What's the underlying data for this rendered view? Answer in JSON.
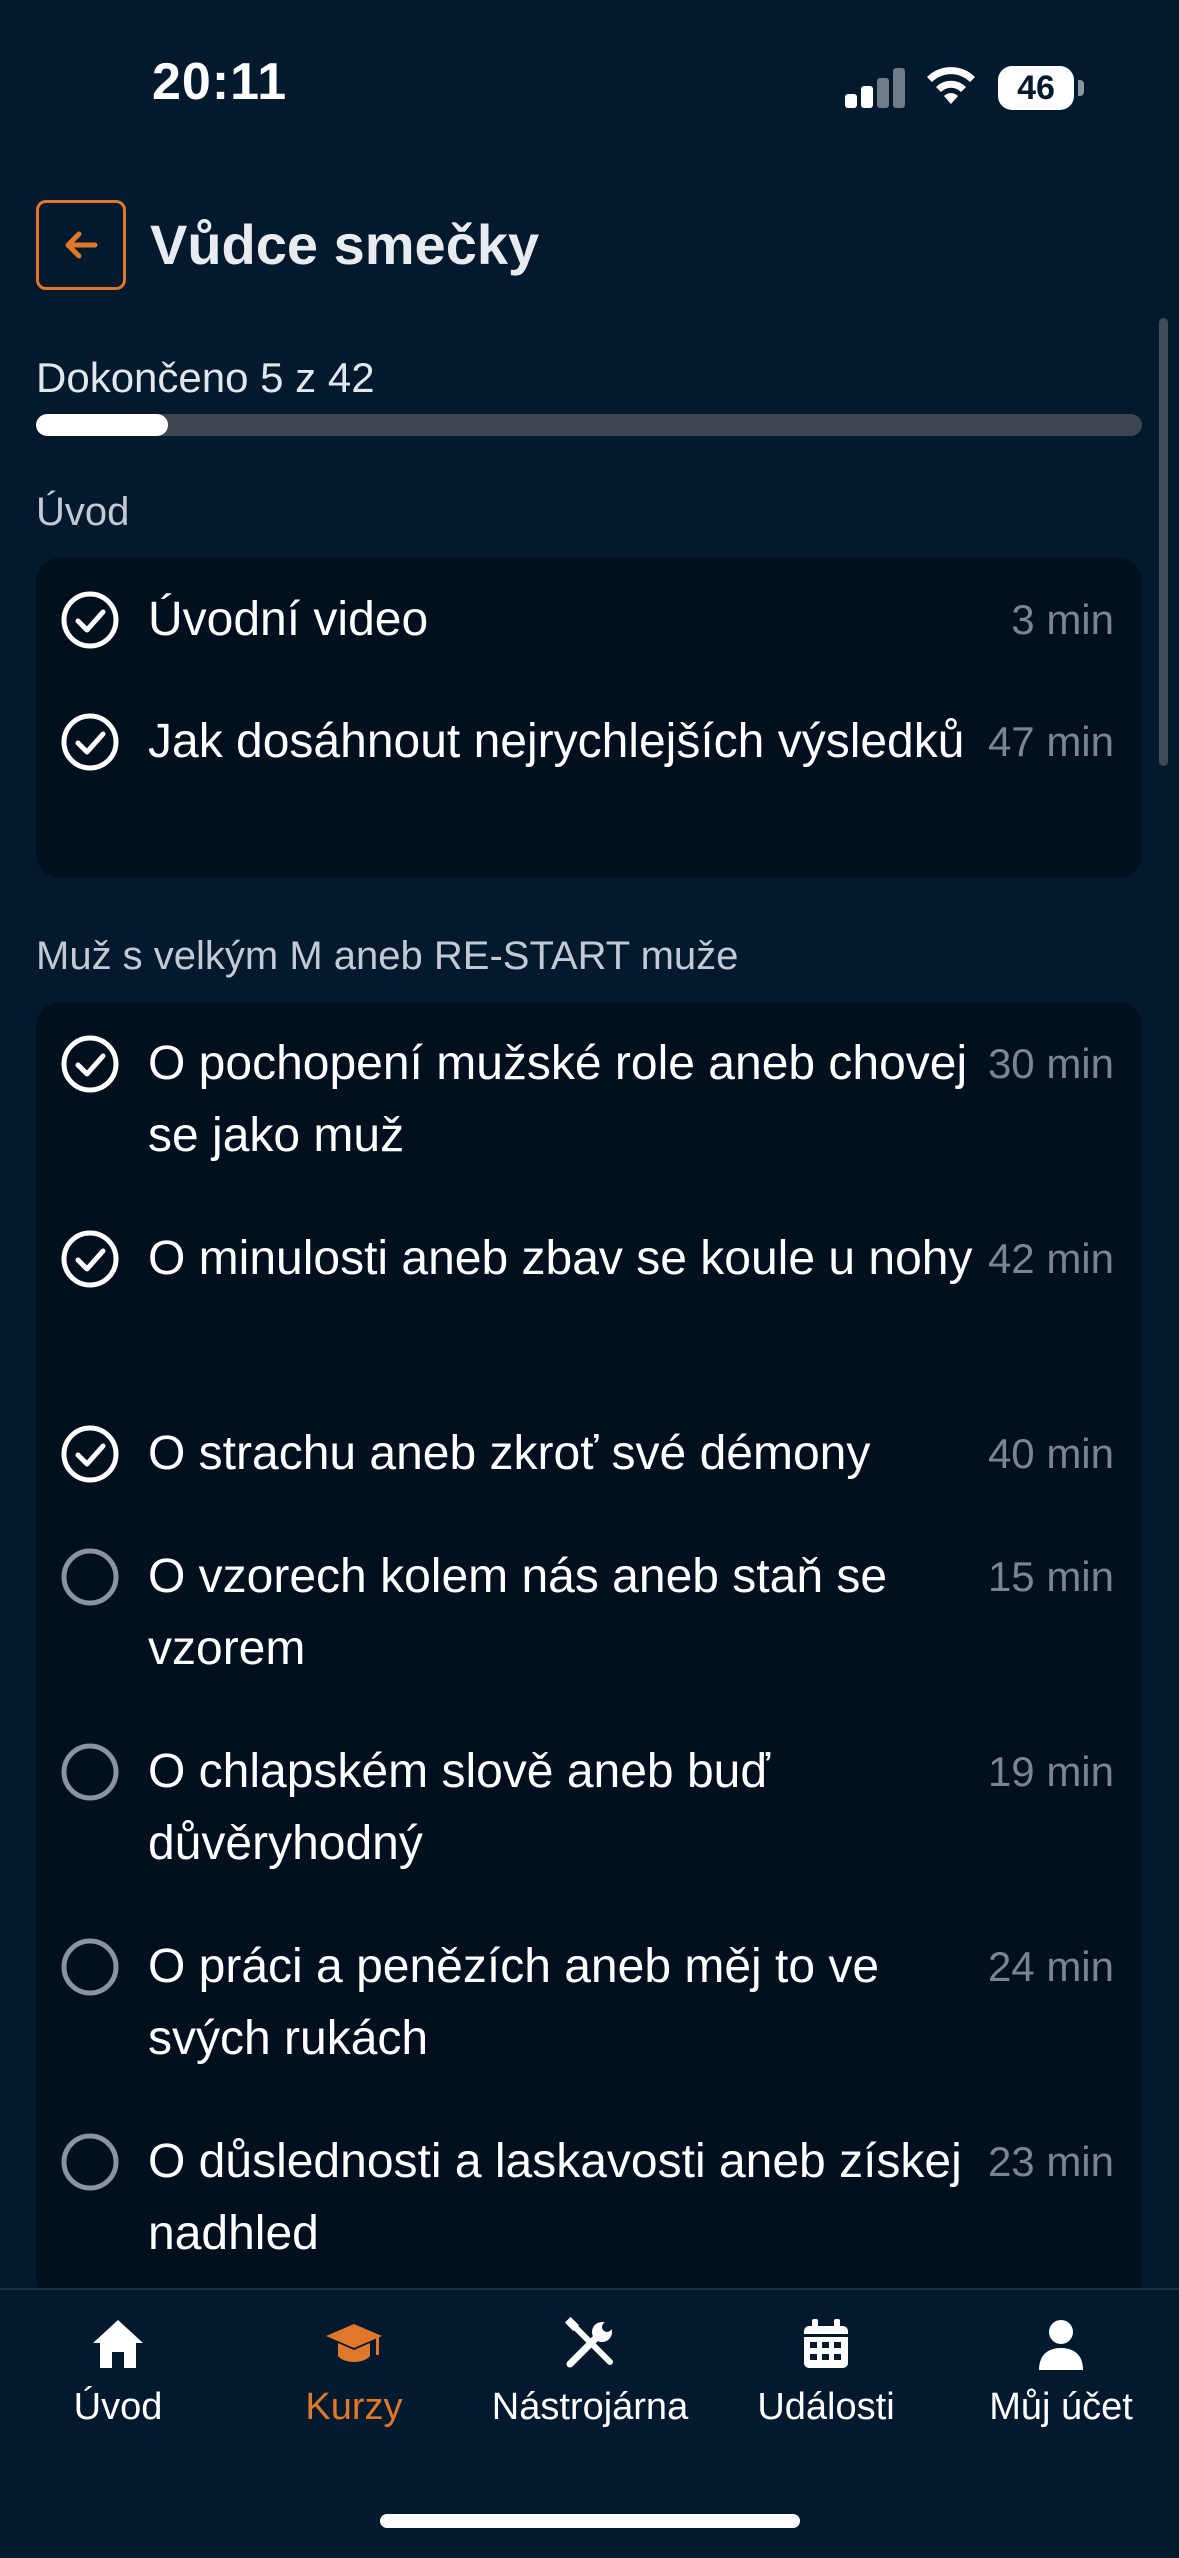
{
  "status_bar": {
    "time": "20:11",
    "battery": "46"
  },
  "header": {
    "title": "Vůdce smečky",
    "back_icon": "arrow-left-icon"
  },
  "progress": {
    "label": "Dokončeno 5 z 42",
    "completed": 5,
    "total": 42
  },
  "sections": [
    {
      "title": "Úvod",
      "items": [
        {
          "title": "Úvodní video",
          "duration": "3 min",
          "done": true
        },
        {
          "title": "Jak dosáhnout nejrychlejších výsledků",
          "duration": "47 min",
          "done": true
        }
      ]
    },
    {
      "title": "Muž s velkým M aneb RE-START muže",
      "items": [
        {
          "title": "O pochopení mužské role aneb chovej se jako muž",
          "duration": "30 min",
          "done": true
        },
        {
          "title": "O minulosti aneb zbav se koule u nohy",
          "duration": "42 min",
          "done": true
        },
        {
          "title": "O strachu aneb zkroť své démony",
          "duration": "40 min",
          "done": true
        },
        {
          "title": "O vzorech kolem nás aneb staň se vzorem",
          "duration": "15 min",
          "done": false
        },
        {
          "title": "O chlapském slově aneb buď důvěryhodný",
          "duration": "19 min",
          "done": false
        },
        {
          "title": "O práci a penězích aneb měj to ve svých rukách",
          "duration": "24 min",
          "done": false
        },
        {
          "title": "O důslednosti a laskavosti aneb získej nadhled",
          "duration": "23 min",
          "done": false
        }
      ]
    }
  ],
  "nav": {
    "items": [
      {
        "label": "Úvod",
        "icon": "home-icon"
      },
      {
        "label": "Kurzy",
        "icon": "graduation-cap-icon",
        "active": true
      },
      {
        "label": "Nástrojárna",
        "icon": "tools-icon"
      },
      {
        "label": "Události",
        "icon": "calendar-icon"
      },
      {
        "label": "Můj účet",
        "icon": "user-icon"
      }
    ]
  },
  "colors": {
    "background": "#031a2e",
    "card": "#020f1e",
    "accent": "#e0782b",
    "muted": "#7b8591"
  }
}
